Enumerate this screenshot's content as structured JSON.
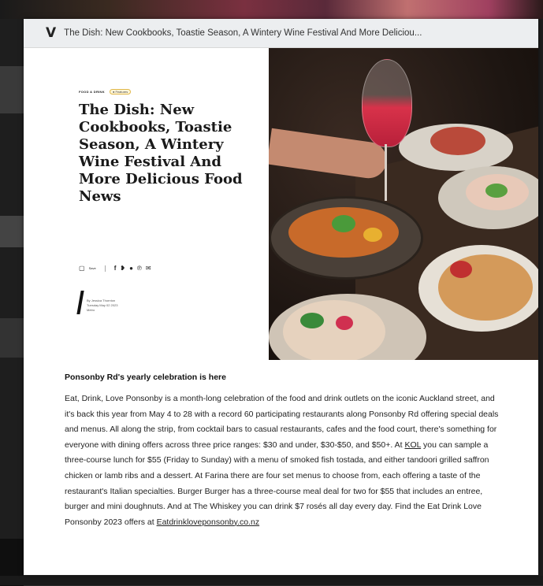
{
  "window": {
    "tab_title": "The Dish: New Cookbooks, Toastie Season, A Wintery Wine Festival And More Deliciou..."
  },
  "article": {
    "breadcrumb": "FOOD & DRINK",
    "tag": "● Features",
    "headline": "The Dish: New Cookbooks, Toastie Season, A Wintery Wine Festival And More Delicious Food News",
    "share_label": "Save",
    "byline": "By Jessica Thornton",
    "date": "Tuesday May 02 2023",
    "byline_extra": "Metro"
  },
  "icons": {
    "logo": "V",
    "save": "bookmark-icon",
    "facebook": "facebook-icon",
    "twitter": "twitter-icon",
    "whatsapp": "whatsapp-icon",
    "pinterest": "pinterest-icon",
    "email": "email-icon"
  },
  "section": {
    "subhead": "Ponsonby Rd's yearly celebration is here",
    "text_1": "Eat, Drink, Love Ponsonby is a month-long celebration of the food and drink outlets on the iconic Auckland street, and it's back this year from May 4 to 28 with a record 60 participating restaurants along Ponsonby Rd offering special deals and menus. All along the strip, from cocktail bars to casual restaurants, cafes and the food court, there's something for everyone with dining offers across three price ranges: $30 and under, $30-$50, and $50+. At ",
    "link_1": "KOL",
    "text_2": " you can sample a three-course lunch for $55 (Friday to Sunday) with a menu of smoked fish tostada, and either tandoori grilled saffron chicken or lamb ribs and a dessert. At Farina there are four set menus to choose from, each offering a taste of the restaurant's Italian specialties. Burger Burger has a three-course meal deal for two for $55 that includes an entree, burger and mini doughnuts. And at The Whiskey you can drink $7 rosés all day every day. Find the Eat Drink Love Ponsonby 2023 offers at ",
    "link_2": "Eatdrinkloveponsonby.co.nz"
  },
  "colors": {
    "background": "#2a2a2a",
    "titlebar": "#eceef0",
    "wine": "#d8324a",
    "accent_pill": "#e0b84a"
  }
}
